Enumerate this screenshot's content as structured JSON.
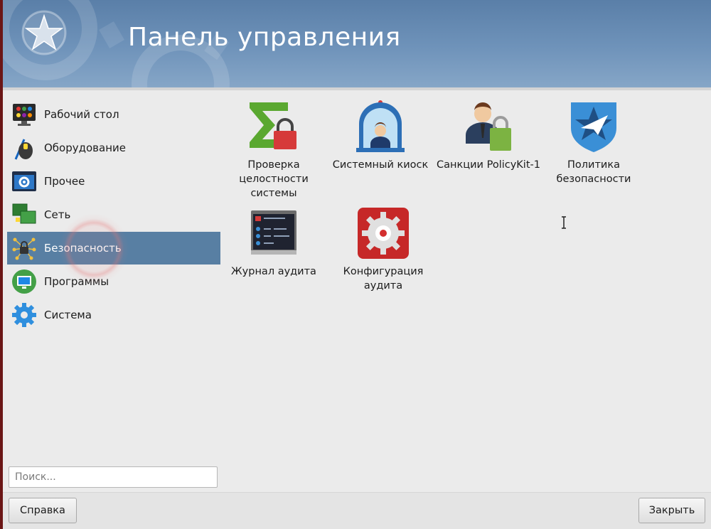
{
  "window": {
    "title": "Панель управления"
  },
  "sidebar": {
    "items": [
      {
        "label": "Рабочий стол",
        "icon": "desktop-icon"
      },
      {
        "label": "Оборудование",
        "icon": "hardware-icon"
      },
      {
        "label": "Прочее",
        "icon": "other-icon"
      },
      {
        "label": "Сеть",
        "icon": "network-icon"
      },
      {
        "label": "Безопасность",
        "icon": "security-icon",
        "selected": true
      },
      {
        "label": "Программы",
        "icon": "programs-icon"
      },
      {
        "label": "Система",
        "icon": "system-gear-icon"
      }
    ]
  },
  "apps": [
    {
      "label": "Проверка целостности системы",
      "icon": "integrity-check-icon"
    },
    {
      "label": "Системный киоск",
      "icon": "kiosk-icon"
    },
    {
      "label": "Санкции PolicyKit-1",
      "icon": "policykit-icon"
    },
    {
      "label": "Политика безопасности",
      "icon": "security-policy-icon"
    },
    {
      "label": "Журнал аудита",
      "icon": "audit-log-icon"
    },
    {
      "label": "Конфигурация аудита",
      "icon": "audit-config-icon"
    }
  ],
  "search": {
    "placeholder": "Поиск...",
    "value": ""
  },
  "footer": {
    "help_label": "Справка",
    "close_label": "Закрыть"
  },
  "colors": {
    "header": "#6f93ba",
    "selection": "#587fa3",
    "background": "#ebebeb"
  }
}
